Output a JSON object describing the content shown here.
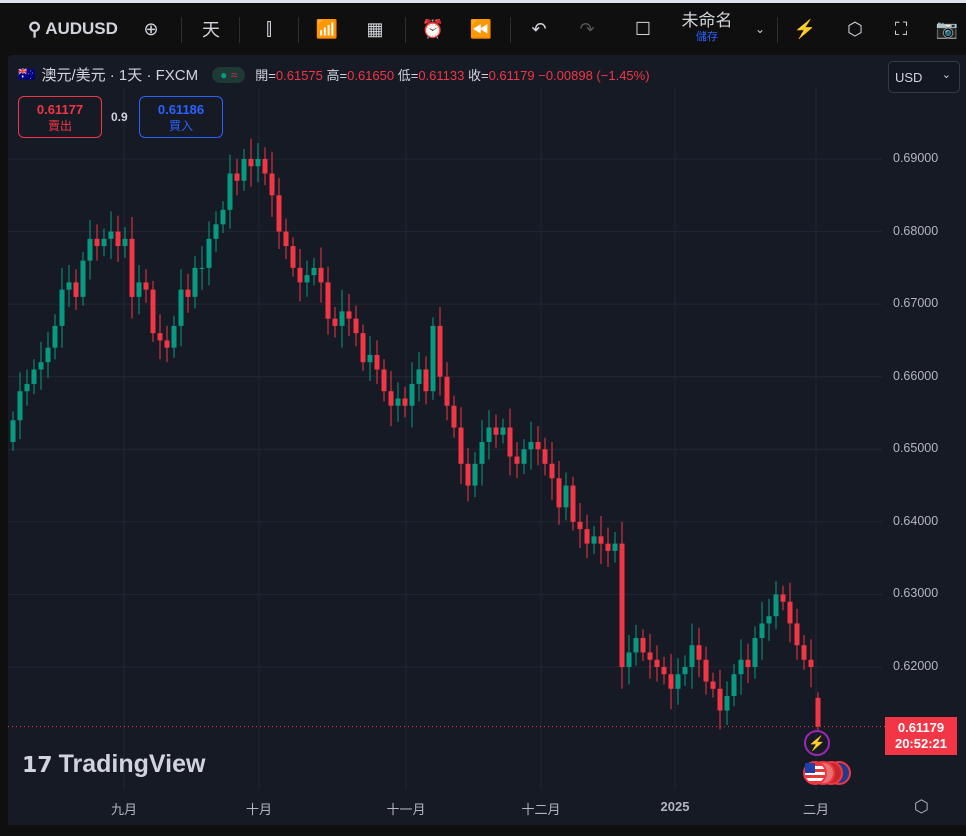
{
  "toolbar": {
    "symbol": "AUDUSD",
    "interval": "天",
    "layout_name": "未命名",
    "save_label": "儲存"
  },
  "legend": {
    "title": "澳元/美元 · 1天 · FXCM",
    "open_label": "開=",
    "open": "0.61575",
    "high_label": "高=",
    "high": "0.61650",
    "low_label": "低=",
    "low": "0.61133",
    "close_label": "收=",
    "close": "0.61179",
    "change": "−0.00898 (−1.45%)"
  },
  "trade": {
    "sell_price": "0.61177",
    "sell_label": "賣出",
    "spread": "0.9",
    "buy_price": "0.61186",
    "buy_label": "買入"
  },
  "currency": "USD",
  "last_price": {
    "price": "0.61179",
    "countdown": "20:52:21"
  },
  "logo": "TradingView",
  "colors": {
    "up": "#089981",
    "down": "#f23645",
    "bg": "#161a25"
  },
  "chart_data": {
    "type": "candlestick",
    "price_ticks": [
      "0.69000",
      "0.68000",
      "0.67000",
      "0.66000",
      "0.65000",
      "0.64000",
      "0.63000",
      "0.62000"
    ],
    "price_tick_values": [
      0.69,
      0.68,
      0.67,
      0.66,
      0.65,
      0.64,
      0.63,
      0.62
    ],
    "time_ticks": [
      "九月",
      "十月",
      "十一月",
      "十二月",
      "2025",
      "二月"
    ],
    "closes": [
      0.654,
      0.658,
      0.659,
      0.661,
      0.662,
      0.664,
      0.667,
      0.672,
      0.673,
      0.671,
      0.676,
      0.679,
      0.678,
      0.679,
      0.68,
      0.678,
      0.679,
      0.671,
      0.673,
      0.672,
      0.666,
      0.665,
      0.664,
      0.667,
      0.672,
      0.671,
      0.675,
      0.675,
      0.679,
      0.681,
      0.683,
      0.688,
      0.687,
      0.69,
      0.689,
      0.69,
      0.688,
      0.685,
      0.68,
      0.678,
      0.675,
      0.673,
      0.674,
      0.675,
      0.673,
      0.668,
      0.667,
      0.669,
      0.668,
      0.666,
      0.662,
      0.663,
      0.661,
      0.658,
      0.656,
      0.657,
      0.656,
      0.659,
      0.661,
      0.658,
      0.667,
      0.66,
      0.656,
      0.653,
      0.648,
      0.645,
      0.648,
      0.651,
      0.653,
      0.652,
      0.653,
      0.649,
      0.648,
      0.65,
      0.651,
      0.65,
      0.648,
      0.646,
      0.642,
      0.645,
      0.64,
      0.639,
      0.637,
      0.638,
      0.637,
      0.636,
      0.637,
      0.62,
      0.622,
      0.624,
      0.622,
      0.621,
      0.62,
      0.619,
      0.617,
      0.619,
      0.62,
      0.623,
      0.621,
      0.618,
      0.617,
      0.614,
      0.616,
      0.619,
      0.621,
      0.62,
      0.624,
      0.626,
      0.627,
      0.63,
      0.629,
      0.626,
      0.623,
      0.621,
      0.62
    ],
    "last_candle": {
      "open": 0.61575,
      "high": 0.6165,
      "low": 0.61133,
      "close": 0.61179
    }
  }
}
